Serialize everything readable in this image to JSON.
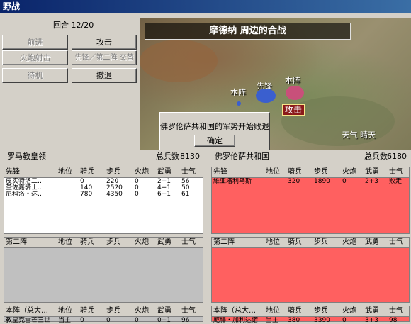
{
  "window": {
    "title": "野战"
  },
  "controls": {
    "round_label": "回合 12/20",
    "buttons": [
      {
        "label": "前进",
        "enabled": false
      },
      {
        "label": "攻击",
        "enabled": true
      },
      {
        "label": "火炮射击",
        "enabled": false
      },
      {
        "label": "先锋／第二阵 交替",
        "enabled": false
      },
      {
        "label": "待机",
        "enabled": false
      },
      {
        "label": "撤退",
        "enabled": true
      }
    ]
  },
  "map": {
    "title": "摩德纳 周边的合战",
    "labels": {
      "main_left": "本阵",
      "vanguard": "先锋",
      "main_right": "本阵"
    },
    "attack_marker": "攻击",
    "weather": "天气 晴天",
    "colors": {
      "blue_army": "#3a5fcf",
      "red_army": "#c8507a"
    }
  },
  "dialog": {
    "message": "佛罗伦萨共和国的军势开始败退",
    "ok_label": "确定"
  },
  "left_side": {
    "faction": "罗马教皇领",
    "total_label": "总兵数",
    "total": "8130",
    "vanguard": {
      "columns": [
        "先锋",
        "地位",
        "骑兵",
        "步兵",
        "火炮",
        "武勇",
        "士气"
      ],
      "rows": [
        [
          "皮实特洛二…",
          "",
          "0",
          "220",
          "0",
          "2+1",
          "56"
        ],
        [
          "圣佐嘉骑士…",
          "",
          "140",
          "2520",
          "0",
          "4+1",
          "50"
        ],
        [
          "尼科洛・达…",
          "",
          "780",
          "4350",
          "0",
          "6+1",
          "61"
        ]
      ]
    },
    "second": {
      "columns": [
        "第二阵",
        "地位",
        "骑兵",
        "步兵",
        "火炮",
        "武勇",
        "士气"
      ],
      "rows": []
    },
    "main": {
      "columns": [
        "本阵（总大…",
        "地位",
        "骑兵",
        "步兵",
        "火炮",
        "武勇",
        "士气"
      ],
      "rows": [
        [
          "教皇克雷芒三世",
          "当主",
          "0",
          "0",
          "0",
          "0+1",
          "96"
        ]
      ]
    },
    "colors": {
      "panel_bg": "#ffffff",
      "second_bg": "#c0c0c0"
    }
  },
  "right_side": {
    "faction": "佛罗伦萨共和国",
    "total_label": "总兵数",
    "total": "6180",
    "vanguard": {
      "columns": [
        "先锋",
        "地位",
        "骑兵",
        "步兵",
        "火炮",
        "武勇",
        "士气"
      ],
      "rows": [
        [
          "維亚塔利乌斯",
          "",
          "320",
          "1890",
          "0",
          "2+3",
          "败走"
        ]
      ]
    },
    "second": {
      "columns": [
        "第二阵",
        "地位",
        "骑兵",
        "步兵",
        "火炮",
        "武勇",
        "士气"
      ],
      "rows": []
    },
    "main": {
      "columns": [
        "本阵（总大…",
        "地位",
        "骑兵",
        "步兵",
        "火炮",
        "武勇",
        "士气"
      ],
      "rows": [
        [
          "威腓・加利达诺",
          "当主",
          "380",
          "3390",
          "0",
          "3+3",
          "98"
        ]
      ]
    },
    "colors": {
      "panel_bg": "#ff6060"
    }
  }
}
